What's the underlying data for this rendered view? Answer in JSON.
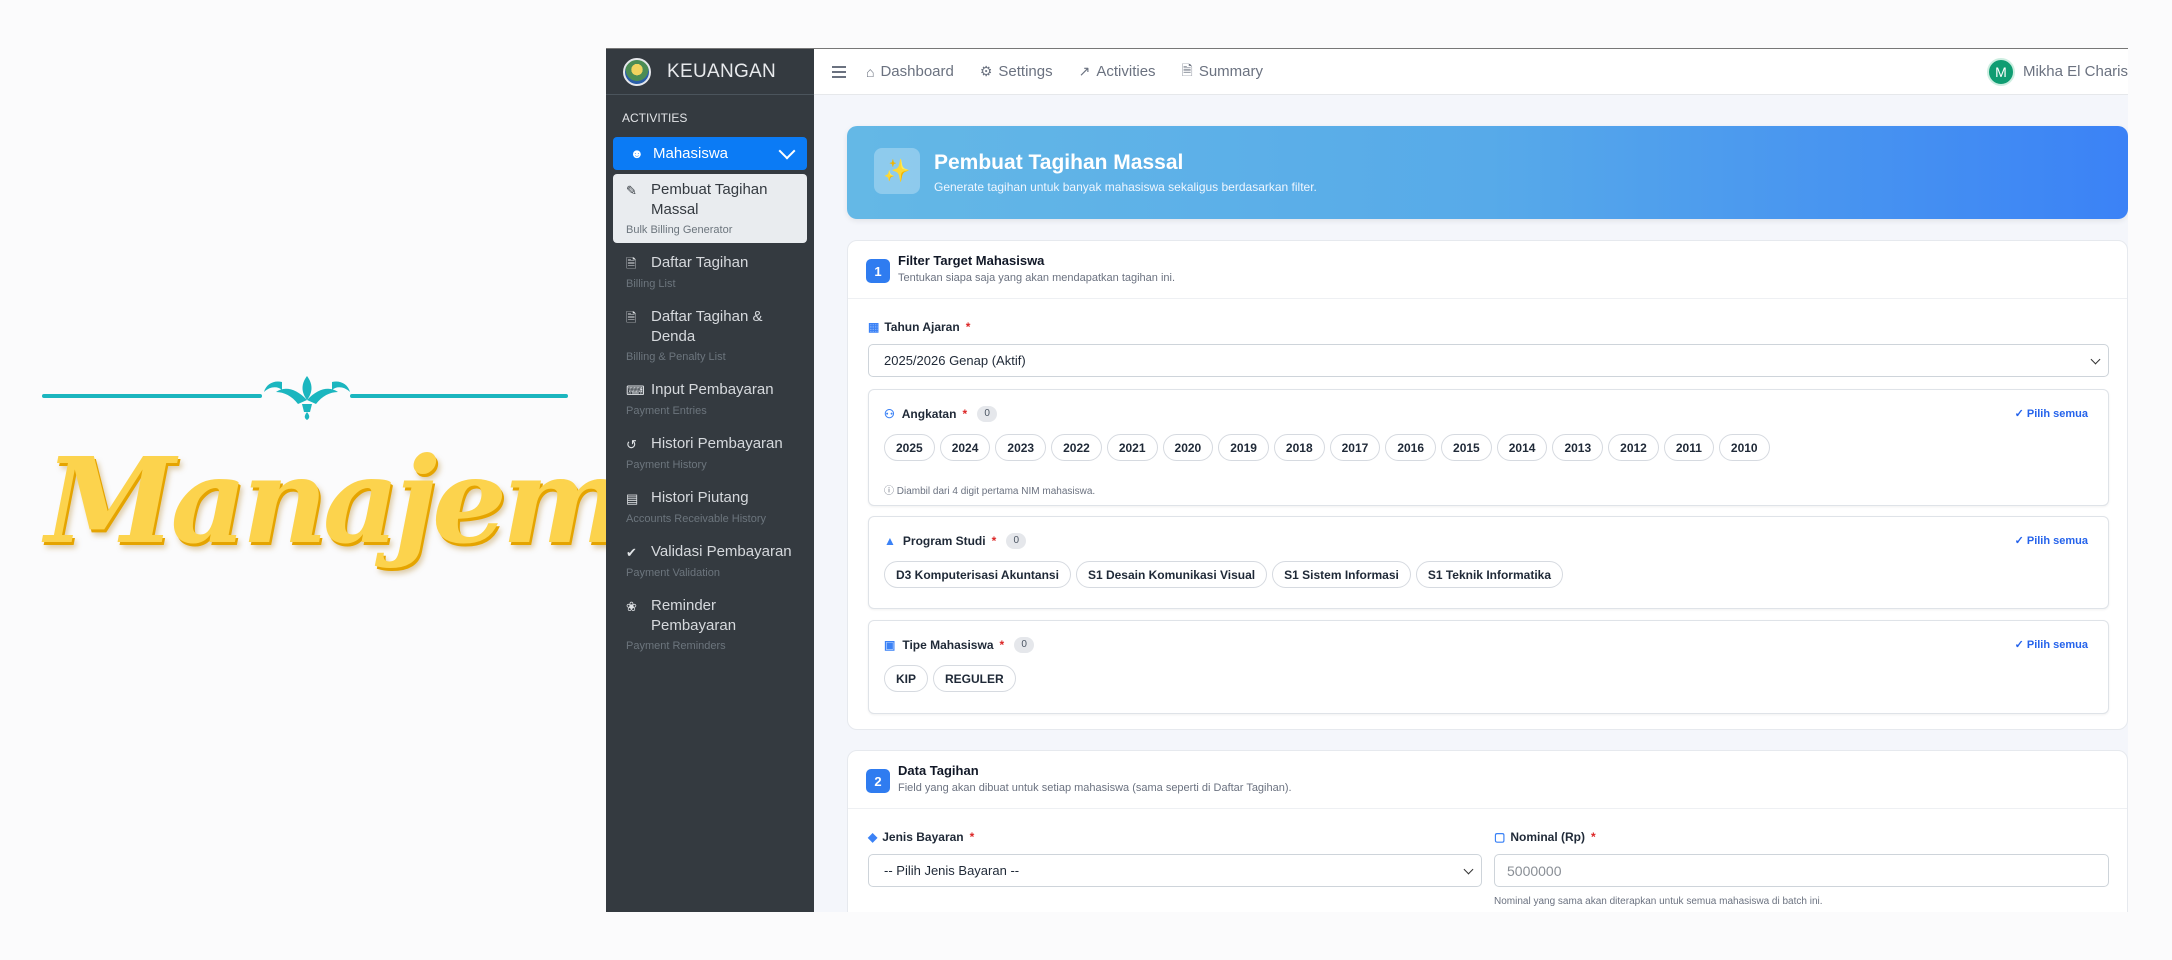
{
  "brand_art": {
    "word": "Manajemen"
  },
  "sidebar": {
    "brand": "KEUANGAN",
    "section": "ACTIVITIES",
    "parent": {
      "label": "Mahasiswa",
      "icon": "user-graduate-icon"
    },
    "items": [
      {
        "label": "Pembuat Tagihan Massal",
        "sub": "Bulk Billing Generator",
        "icon": "pencil-icon",
        "active": true
      },
      {
        "label": "Daftar Tagihan",
        "sub": "Billing List",
        "icon": "file-invoice-icon"
      },
      {
        "label": "Daftar Tagihan & Denda",
        "sub": "Billing & Penalty List",
        "icon": "file-penalty-icon"
      },
      {
        "label": "Input Pembayaran",
        "sub": "Payment Entries",
        "icon": "keyboard-icon"
      },
      {
        "label": "Histori Pembayaran",
        "sub": "Payment History",
        "icon": "history-icon"
      },
      {
        "label": "Histori Piutang",
        "sub": "Accounts Receivable History",
        "icon": "book-icon"
      },
      {
        "label": "Validasi Pembayaran",
        "sub": "Payment Validation",
        "icon": "check-circle-icon"
      },
      {
        "label": "Reminder Pembayaran",
        "sub": "Payment Reminders",
        "icon": "bell-icon"
      }
    ]
  },
  "topbar": {
    "nav": [
      {
        "label": "Dashboard",
        "icon": "home-icon"
      },
      {
        "label": "Settings",
        "icon": "gear-icon"
      },
      {
        "label": "Activities",
        "icon": "chart-line-icon"
      },
      {
        "label": "Summary",
        "icon": "file-icon"
      }
    ],
    "user_initial": "M",
    "user_name": "Mikha El Charis"
  },
  "hero": {
    "title": "Pembuat Tagihan Massal",
    "subtitle": "Generate tagihan untuk banyak mahasiswa sekaligus berdasarkan filter."
  },
  "filter": {
    "step": "1",
    "title": "Filter Target Mahasiswa",
    "desc": "Tentukan siapa saja yang akan mendapatkan tagihan ini.",
    "tahun_label": "Tahun Ajaran",
    "tahun_value": "2025/2026 Genap (Aktif)",
    "required_mark": "*",
    "pick_all": "Pilih semua",
    "angkatan": {
      "label": "Angkatan",
      "count": "0",
      "options": [
        "2025",
        "2024",
        "2023",
        "2022",
        "2021",
        "2020",
        "2019",
        "2018",
        "2017",
        "2016",
        "2015",
        "2014",
        "2013",
        "2012",
        "2011",
        "2010"
      ],
      "hint": "ⓘ Diambil dari 4 digit pertama NIM mahasiswa."
    },
    "prodi": {
      "label": "Program Studi",
      "count": "0",
      "options": [
        "D3 Komputerisasi Akuntansi",
        "S1 Desain Komunikasi Visual",
        "S1 Sistem Informasi",
        "S1 Teknik Informatika"
      ]
    },
    "tipe": {
      "label": "Tipe Mahasiswa",
      "count": "0",
      "options": [
        "KIP",
        "REGULER"
      ]
    }
  },
  "billing": {
    "step": "2",
    "title": "Data Tagihan",
    "desc": "Field yang akan dibuat untuk setiap mahasiswa (sama seperti di Daftar Tagihan).",
    "jenis_label": "Jenis Bayaran",
    "jenis_value": "-- Pilih Jenis Bayaran --",
    "nominal_label": "Nominal (Rp)",
    "nominal_placeholder": "5000000",
    "nominal_help": "Nominal yang sama akan diterapkan untuk semua mahasiswa di batch ini."
  },
  "colors": {
    "accent": "#0b7bf5",
    "sidebar": "#343a40",
    "hero_start": "#64b8e6",
    "hero_end": "#3b82f6",
    "required": "#dc2626"
  }
}
